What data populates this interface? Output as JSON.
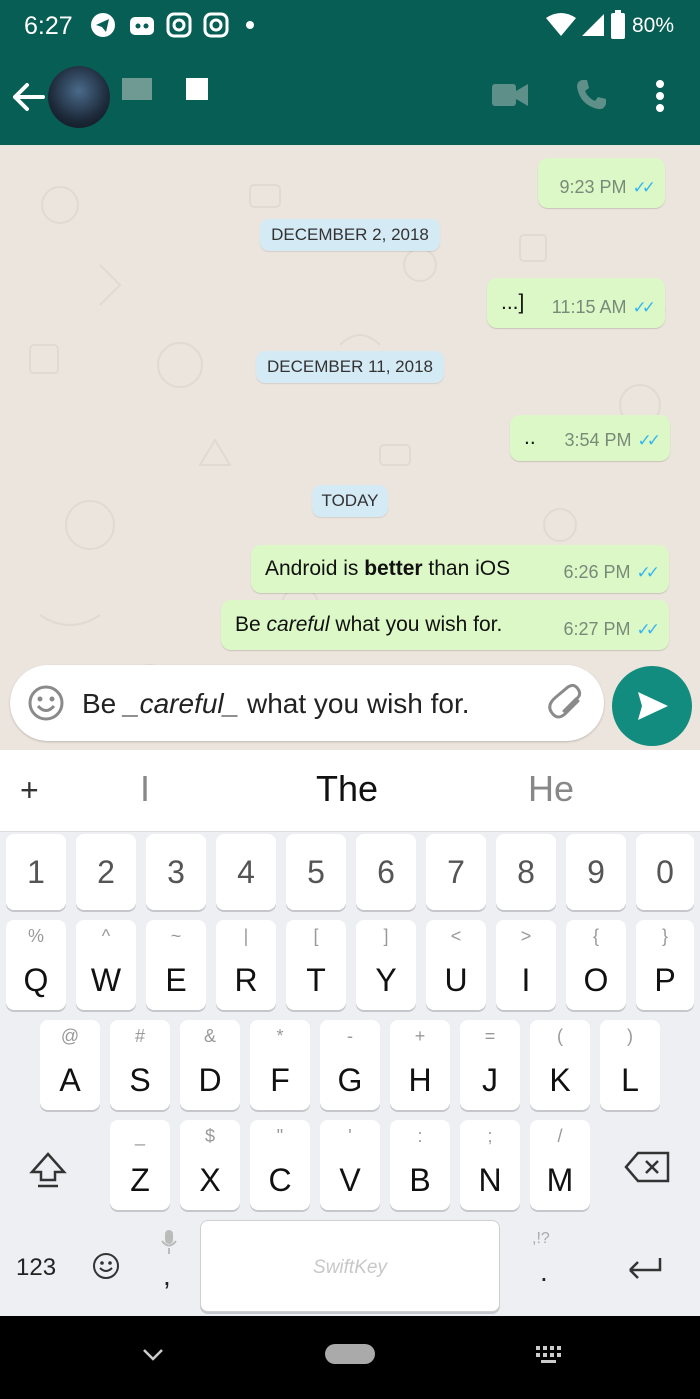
{
  "status_bar": {
    "time": "6:27",
    "battery": "80%",
    "icons": [
      "telegram-icon",
      "discord-icon",
      "instagram-icon",
      "instagram-icon",
      "dot-icon"
    ]
  },
  "app_bar": {
    "contact_name": "",
    "icons": [
      "back-arrow-icon",
      "video-call-icon",
      "phone-icon",
      "more-vert-icon"
    ]
  },
  "chat": {
    "messages": [
      {
        "text": "",
        "time": "9:23 PM"
      },
      {
        "date": "DECEMBER 2, 2018"
      },
      {
        "text": "...]",
        "time": "11:15 AM"
      },
      {
        "date": "DECEMBER 11, 2018"
      },
      {
        "text": "..",
        "time": "3:54 PM"
      },
      {
        "date": "TODAY"
      },
      {
        "text_parts": [
          "Android is ",
          "better",
          " than iOS"
        ],
        "time": "6:26 PM"
      },
      {
        "text_parts": [
          "Be ",
          "careful",
          " what you wish for."
        ],
        "time": "6:27 PM"
      }
    ]
  },
  "composer": {
    "value_parts": [
      "Be ",
      "_careful_",
      " what you wish for."
    ]
  },
  "keyboard": {
    "suggestions": [
      "I",
      "The",
      "He"
    ],
    "plus": "+",
    "number_row": [
      "1",
      "2",
      "3",
      "4",
      "5",
      "6",
      "7",
      "8",
      "9",
      "0"
    ],
    "row1": [
      [
        "Q",
        "%"
      ],
      [
        "W",
        "^"
      ],
      [
        "E",
        "~"
      ],
      [
        "R",
        "|"
      ],
      [
        "T",
        "["
      ],
      [
        "Y",
        "]"
      ],
      [
        "U",
        "<"
      ],
      [
        "I",
        ">"
      ],
      [
        "O",
        "{"
      ],
      [
        "P",
        "}"
      ]
    ],
    "row2": [
      [
        "A",
        "@"
      ],
      [
        "S",
        "#"
      ],
      [
        "D",
        "&"
      ],
      [
        "F",
        "*"
      ],
      [
        "G",
        "-"
      ],
      [
        "H",
        "+"
      ],
      [
        "J",
        "="
      ],
      [
        "K",
        "("
      ],
      [
        "L",
        ")"
      ]
    ],
    "row3": [
      [
        "Z",
        "_"
      ],
      [
        "X",
        "$"
      ],
      [
        "C",
        "\""
      ],
      [
        "V",
        "'"
      ],
      [
        "B",
        ":"
      ],
      [
        "N",
        ";"
      ],
      [
        "M",
        "/"
      ]
    ],
    "symbols_label": "123",
    "comma": ",",
    "period": ".",
    "punct_hint": ",!?",
    "space_label": "SwiftKey"
  }
}
